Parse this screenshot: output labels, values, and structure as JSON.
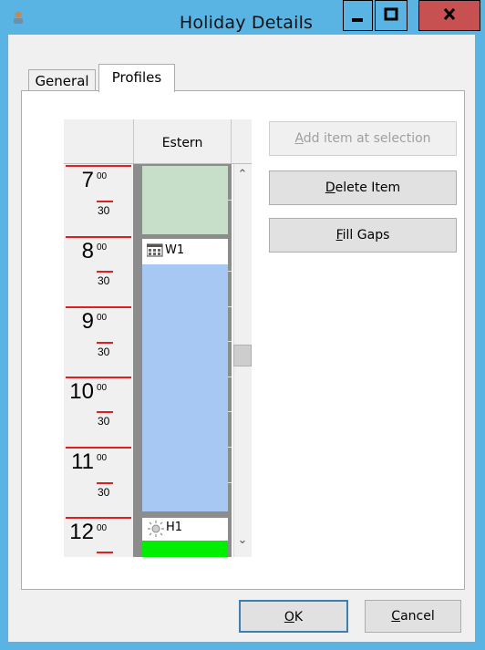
{
  "window": {
    "title": "Holiday Details",
    "min_icon": "minimize-icon",
    "max_icon": "maximize-icon",
    "close_icon": "close-icon"
  },
  "tabs": {
    "general": "General",
    "profiles": "Profiles"
  },
  "scheduler": {
    "column_header": "Estern",
    "hours": [
      {
        "hour": "7",
        "min": "00",
        "half": "30"
      },
      {
        "hour": "8",
        "min": "00",
        "half": "30"
      },
      {
        "hour": "9",
        "min": "00",
        "half": "30"
      },
      {
        "hour": "10",
        "min": "00",
        "half": "30"
      },
      {
        "hour": "11",
        "min": "00",
        "half": "30"
      },
      {
        "hour": "12",
        "min": "00"
      }
    ],
    "items": [
      {
        "label": "W1",
        "icon": "week-calendar-icon"
      },
      {
        "label": "H1",
        "icon": "holiday-sun-icon"
      }
    ],
    "colors": {
      "green_block": "#c7dfc8",
      "blue_block": "#a8c8f4",
      "h1_bar": "#00ee00",
      "hour_line": "#e02020"
    }
  },
  "buttons": {
    "add": {
      "pre": "",
      "u": "A",
      "post": "dd item at selection"
    },
    "delete": {
      "pre": "",
      "u": "D",
      "post": "elete Item"
    },
    "fill": {
      "pre": "",
      "u": "F",
      "post": "ill Gaps"
    },
    "ok": {
      "pre": "",
      "u": "O",
      "post": "K"
    },
    "cancel": {
      "pre": "",
      "u": "C",
      "post": "ancel"
    }
  }
}
